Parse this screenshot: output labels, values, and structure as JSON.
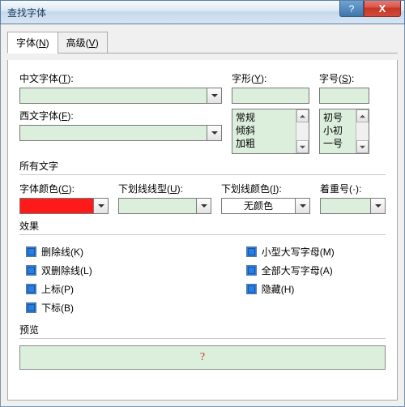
{
  "window": {
    "title": "查找字体",
    "help": "?",
    "close": "X"
  },
  "tabs": {
    "font": {
      "label": "字体(",
      "key": "N",
      "after": ")"
    },
    "adv": {
      "label": "高级(",
      "key": "V",
      "after": ")"
    }
  },
  "labels": {
    "cnfont": {
      "pre": "中文字体(",
      "key": "T",
      "post": "):"
    },
    "style": {
      "pre": "字形(",
      "key": "Y",
      "post": "):"
    },
    "size": {
      "pre": "字号(",
      "key": "S",
      "post": "):"
    },
    "westfont": {
      "pre": "西文字体(",
      "key": "F",
      "post": "):"
    },
    "alltext": "所有文字",
    "fontcolor": {
      "pre": "字体颜色(",
      "key": "C",
      "post": "):"
    },
    "ulstyle": {
      "pre": "下划线线型(",
      "key": "U",
      "post": "):"
    },
    "ulcolor": {
      "pre": "下划线颜色(",
      "key": "I",
      "post": "):"
    },
    "emphasis": {
      "pre": "着重号(·):",
      "key": "",
      "post": ""
    },
    "effects": "效果",
    "preview": "预览"
  },
  "values": {
    "cnfont": "",
    "westfont": "",
    "style": "",
    "size": "",
    "ulstyle": "",
    "ulcolor": "无颜色",
    "emphasis": "",
    "previewChar": "?"
  },
  "styleList": [
    "常规",
    "倾斜",
    "加粗"
  ],
  "sizeList": [
    "初号",
    "小初",
    "一号"
  ],
  "fx": {
    "strike": {
      "pre": "删除线(",
      "key": "K",
      "post": ")"
    },
    "dstrike": {
      "pre": "双删除线(",
      "key": "L",
      "post": ")"
    },
    "super": {
      "pre": "上标(",
      "key": "P",
      "post": ")"
    },
    "sub": {
      "pre": "下标(",
      "key": "B",
      "post": ")"
    },
    "smcaps": {
      "pre": "小型大写字母(",
      "key": "M",
      "post": ")"
    },
    "allcaps": {
      "pre": "全部大写字母(",
      "key": "A",
      "post": ")"
    },
    "hidden": {
      "pre": "隐藏(",
      "key": "H",
      "post": ")"
    }
  }
}
